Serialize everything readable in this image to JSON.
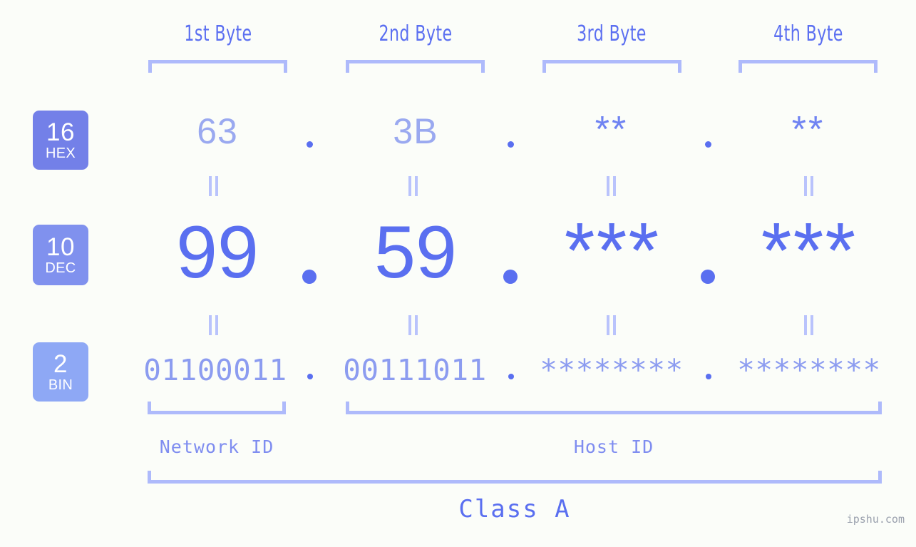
{
  "meta": {
    "background_color": "#fbfdf9",
    "accent_color": "#5a6ff0",
    "bracket_color": "#aebafb",
    "watermark": "ipshu.com"
  },
  "byte_headers": [
    {
      "label": "1st Byte"
    },
    {
      "label": "2nd Byte"
    },
    {
      "label": "3rd Byte"
    },
    {
      "label": "4th Byte"
    }
  ],
  "bases": [
    {
      "number": "16",
      "name": "HEX",
      "color": "#7380e8"
    },
    {
      "number": "10",
      "name": "DEC",
      "color": "#8091ee"
    },
    {
      "number": "2",
      "name": "BIN",
      "color": "#8ea8f5"
    }
  ],
  "rows": {
    "hex": {
      "values": [
        "63",
        "3B",
        "**",
        "**"
      ],
      "separator": "."
    },
    "dec": {
      "values": [
        "99",
        "59",
        "***",
        "***"
      ],
      "separator": "."
    },
    "bin": {
      "values": [
        "01100011",
        "00111011",
        "********",
        "********"
      ],
      "separator": "."
    }
  },
  "equals_marks": {
    "symbol": "=",
    "count_per_row": 4,
    "rows": 2
  },
  "segments": [
    {
      "label": "Network ID"
    },
    {
      "label": "Host ID"
    }
  ],
  "class": {
    "label": "Class A"
  }
}
